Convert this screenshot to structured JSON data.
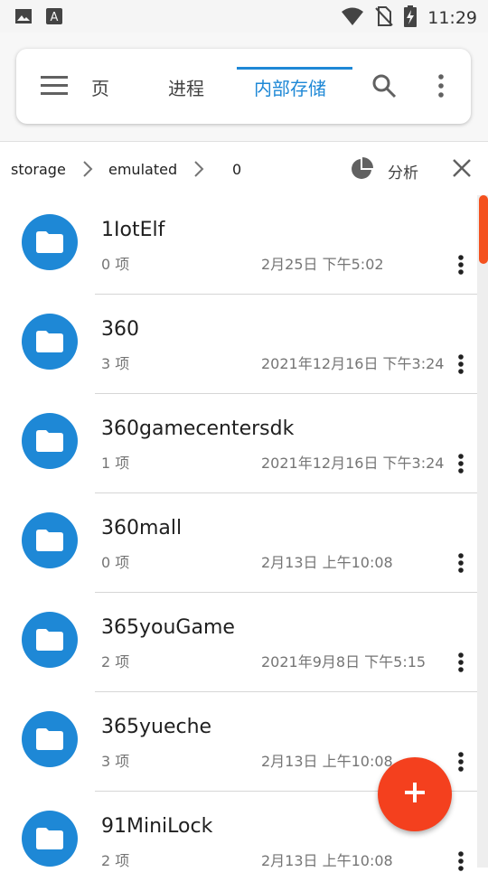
{
  "status_bar": {
    "time": "11:29",
    "icons": [
      "image-icon",
      "keyboard-icon",
      "wifi-icon",
      "no-sim-icon",
      "battery-charging-icon"
    ]
  },
  "tabs": [
    {
      "label": "页",
      "active": false
    },
    {
      "label": "进程",
      "active": false
    },
    {
      "label": "内部存储",
      "active": true
    }
  ],
  "toolbar": {
    "menu_icon": "hamburger-icon",
    "search_icon": "search-icon",
    "more_icon": "more-vert-icon"
  },
  "breadcrumb": {
    "items": [
      "storage",
      "emulated",
      "0"
    ],
    "analyze_label": "分析",
    "accent": "#1e88d6"
  },
  "files": [
    {
      "name": "1IotElf",
      "count": "0 项",
      "date": "2月25日 下午5:02"
    },
    {
      "name": "360",
      "count": "3 项",
      "date": "2021年12月16日 下午3:24"
    },
    {
      "name": "360gamecentersdk",
      "count": "1 项",
      "date": "2021年12月16日 下午3:24"
    },
    {
      "name": "360mall",
      "count": "0 项",
      "date": "2月13日 上午10:08"
    },
    {
      "name": "365youGame",
      "count": "2 项",
      "date": "2021年9月8日 下午5:15"
    },
    {
      "name": "365yueche",
      "count": "3 项",
      "date": "2月13日 上午10:08"
    },
    {
      "name": "91MiniLock",
      "count": "2 项",
      "date": "2月13日 上午10:08"
    }
  ],
  "fab": {
    "icon": "plus-icon",
    "color": "#f4401e"
  }
}
